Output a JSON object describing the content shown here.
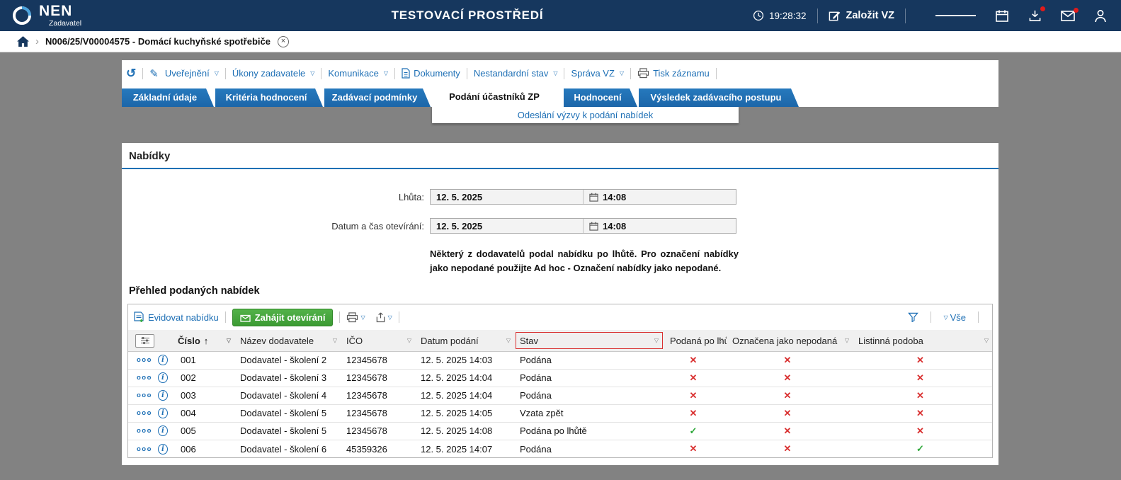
{
  "header": {
    "brand": "NEN",
    "brand_role": "Zadavatel",
    "env_title": "TESTOVACÍ PROSTŘEDÍ",
    "clock": "19:28:32",
    "create_vz": "Založit VZ"
  },
  "breadcrumb": {
    "record": "N006/25/V00004575 - Domácí kuchyňské spotřebiče"
  },
  "toolbar": {
    "items": [
      {
        "label": "Uveřejnění"
      },
      {
        "label": "Úkony zadavatele"
      },
      {
        "label": "Komunikace"
      },
      {
        "label": "Dokumenty"
      },
      {
        "label": "Nestandardní stav"
      },
      {
        "label": "Správa VZ"
      },
      {
        "label": "Tisk záznamu"
      }
    ]
  },
  "tabs": [
    {
      "label": "Základní údaje",
      "active": false
    },
    {
      "label": "Kritéria hodnocení",
      "active": false
    },
    {
      "label": "Zadávací podmínky",
      "active": false
    },
    {
      "label": "Podání účastníků ZP",
      "active": true
    },
    {
      "label": "Hodnocení",
      "active": false
    },
    {
      "label": "Výsledek zadávacího postupu",
      "active": false
    }
  ],
  "subtab_link": "Odeslání výzvy k podání nabídek",
  "section": {
    "title": "Nabídky",
    "fields": [
      {
        "label": "Lhůta:",
        "date": "12. 5. 2025",
        "time": "14:08"
      },
      {
        "label": "Datum a čas otevírání:",
        "date": "12. 5. 2025",
        "time": "14:08"
      }
    ],
    "warning": "Některý z dodavatelů podal nabídku po lhůtě. Pro označení nabídky jako nepodané použijte Ad hoc - Označení nabídky jako nepodané."
  },
  "offers": {
    "title": "Přehled podaných nabídek",
    "toolbar": {
      "record_offer": "Evidovat nabídku",
      "start_opening": "Zahájit otevírání",
      "filter_all": "Vše"
    },
    "columns": [
      "Číslo",
      "Název dodavatele",
      "IČO",
      "Datum podání",
      "Stav",
      "Podaná po lhůtě",
      "Označena jako nepodaná",
      "Listinná podoba"
    ],
    "rows": [
      {
        "cislo": "001",
        "dodavatel": "Dodavatel - školení 2",
        "ico": "12345678",
        "datum": "12. 5. 2025 14:03",
        "stav": "Podána",
        "po_lhute": false,
        "nepodana": false,
        "listinna": false
      },
      {
        "cislo": "002",
        "dodavatel": "Dodavatel - školení 3",
        "ico": "12345678",
        "datum": "12. 5. 2025 14:04",
        "stav": "Podána",
        "po_lhute": false,
        "nepodana": false,
        "listinna": false
      },
      {
        "cislo": "003",
        "dodavatel": "Dodavatel - školení 4",
        "ico": "12345678",
        "datum": "12. 5. 2025 14:04",
        "stav": "Podána",
        "po_lhute": false,
        "nepodana": false,
        "listinna": false
      },
      {
        "cislo": "004",
        "dodavatel": "Dodavatel - školení 5",
        "ico": "12345678",
        "datum": "12. 5. 2025 14:05",
        "stav": "Vzata zpět",
        "po_lhute": false,
        "nepodana": false,
        "listinna": false
      },
      {
        "cislo": "005",
        "dodavatel": "Dodavatel - školení 5",
        "ico": "12345678",
        "datum": "12. 5. 2025 14:08",
        "stav": "Podána po lhůtě",
        "po_lhute": true,
        "nepodana": false,
        "listinna": false
      },
      {
        "cislo": "006",
        "dodavatel": "Dodavatel - školení 6",
        "ico": "45359326",
        "datum": "12. 5. 2025 14:07",
        "stav": "Podána",
        "po_lhute": false,
        "nepodana": false,
        "listinna": true
      }
    ]
  },
  "icons": {
    "check": "✓",
    "cross": "✕",
    "caret": "▽",
    "sort_asc": "↑",
    "kebab": "ooo",
    "history": "↺",
    "pencil": "✎",
    "chevron": "›",
    "close": "×",
    "info": "i"
  },
  "colors": {
    "topbar": "#16375e",
    "accent": "#1d6fb5",
    "tab_blue": "#1e6fb2",
    "green": "#3c9b33",
    "red_mark": "#d93030",
    "green_mark": "#2ea83a",
    "page_bg": "#828282"
  }
}
